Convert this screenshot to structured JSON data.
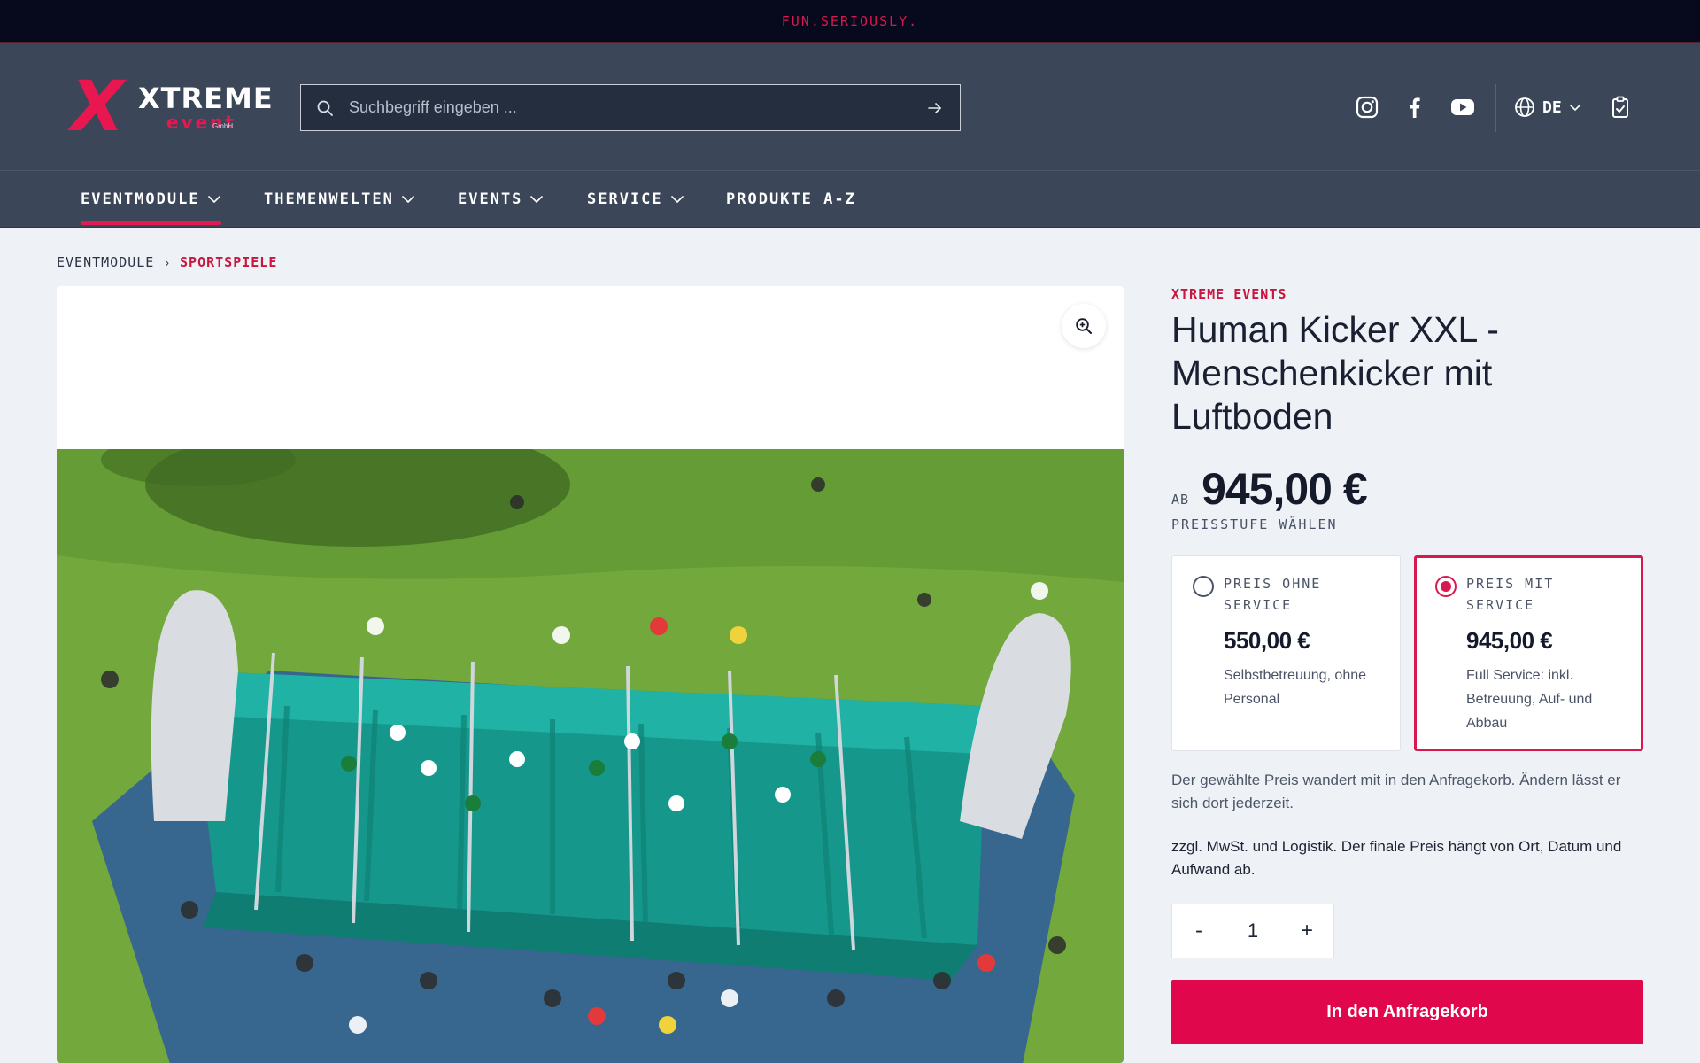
{
  "topbar": {
    "tagline": "FUN.SERIOUSLY."
  },
  "header": {
    "logo": {
      "mark": "X",
      "top": "XTREME",
      "bottom": "event",
      "suffix": "GmbH"
    },
    "search": {
      "placeholder": "Suchbegriff eingeben ...",
      "value": ""
    },
    "social": [
      "instagram-icon",
      "facebook-icon",
      "youtube-icon"
    ],
    "language": "DE"
  },
  "nav": {
    "items": [
      {
        "label": "EVENTMODULE",
        "has_dropdown": true,
        "active": true
      },
      {
        "label": "THEMENWELTEN",
        "has_dropdown": true,
        "active": false
      },
      {
        "label": "EVENTS",
        "has_dropdown": true,
        "active": false
      },
      {
        "label": "SERVICE",
        "has_dropdown": true,
        "active": false
      },
      {
        "label": "PRODUKTE A-Z",
        "has_dropdown": false,
        "active": false
      }
    ]
  },
  "breadcrumb": {
    "parent": "EVENTMODULE",
    "current": "SPORTSPIELE"
  },
  "product": {
    "brand": "XTREME EVENTS",
    "title": "Human Kicker XXL - Menschenkicker mit Luftboden",
    "price_prefix": "AB",
    "price": "945,00 €",
    "price_hint": "PREISSTUFE WÄHLEN",
    "options": [
      {
        "label": "PREIS OHNE SERVICE",
        "price": "550,00 €",
        "description": "Selbstbetreuung, ohne Personal",
        "selected": false
      },
      {
        "label": "PREIS MIT SERVICE",
        "price": "945,00 €",
        "description": "Full Service: inkl. Betreuung, Auf- und Abbau",
        "selected": true
      }
    ],
    "note_basket": "Der gewählte Preis wandert mit in den Anfragekorb. Ändern lässt er sich dort jederzeit.",
    "note_tax": "zzgl. MwSt. und Logistik. Der finale Preis hängt von Ort, Datum und Aufwand ab.",
    "quantity": {
      "minus": "-",
      "value": "1",
      "plus": "+"
    },
    "cta_label": "In den Anfragekorb"
  },
  "colors": {
    "accent": "#e0074c",
    "header_bg": "#3b4659",
    "topbar_bg": "#070a1c",
    "page_bg": "#eef1f6",
    "grass": "#6fa53a",
    "inflatable": "#1ea79a"
  }
}
